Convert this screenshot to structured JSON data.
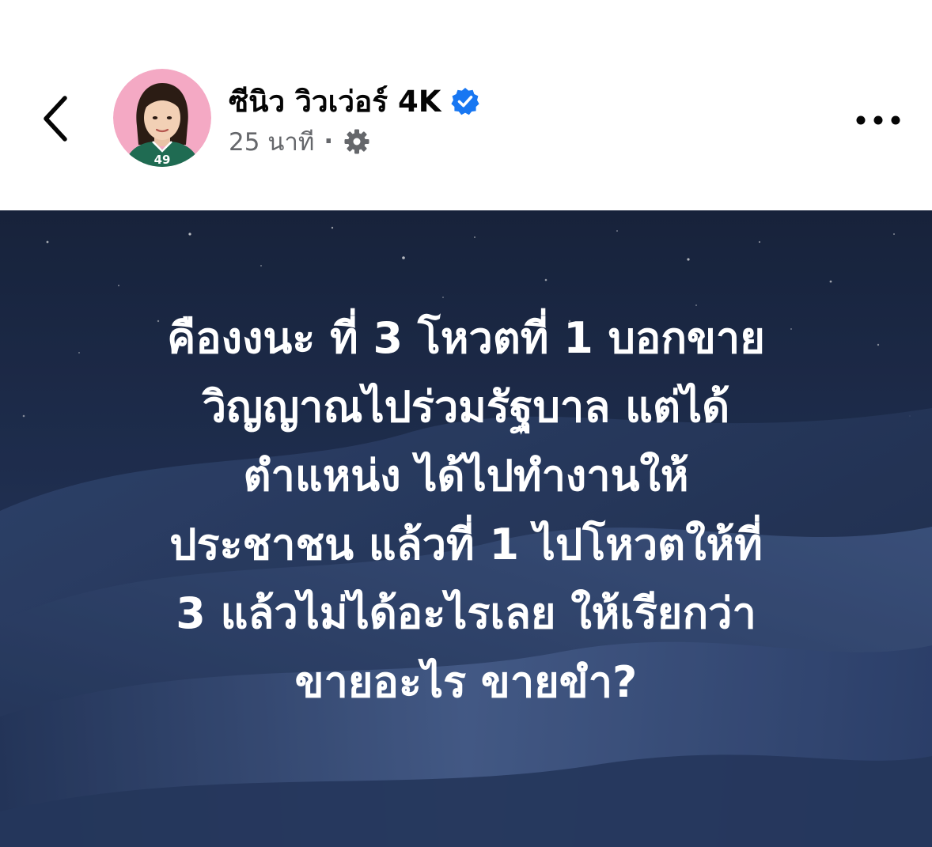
{
  "header": {
    "back_icon": "chevron-left-icon",
    "author_name": "ซีนิว วิวเว่อร์ 4K",
    "verified_icon": "verified-badge-icon",
    "verified_color": "#1877f2",
    "timestamp": "25 นาที",
    "separator": "·",
    "privacy_icon": "gear-icon",
    "more_icon": "more-horizontal-icon"
  },
  "avatar": {
    "jersey_number": "49",
    "background_color": "#f4a9c4"
  },
  "post": {
    "background": "night-sky-desert-dunes",
    "lines": [
      "คืองงนะ ที่ 3 โหวตที่ 1 บอกขาย",
      "วิญญาณไปร่วมรัฐบาล แต่ได้",
      "ตำแหน่ง ได้ไปทำงานให้",
      "ประชาชน แล้วที่ 1 ไปโหวตให้ที่",
      "3 แล้วไม่ได้อะไรเลย ให้เรียกว่า",
      "ขายอะไร ขายขำ?"
    ]
  }
}
